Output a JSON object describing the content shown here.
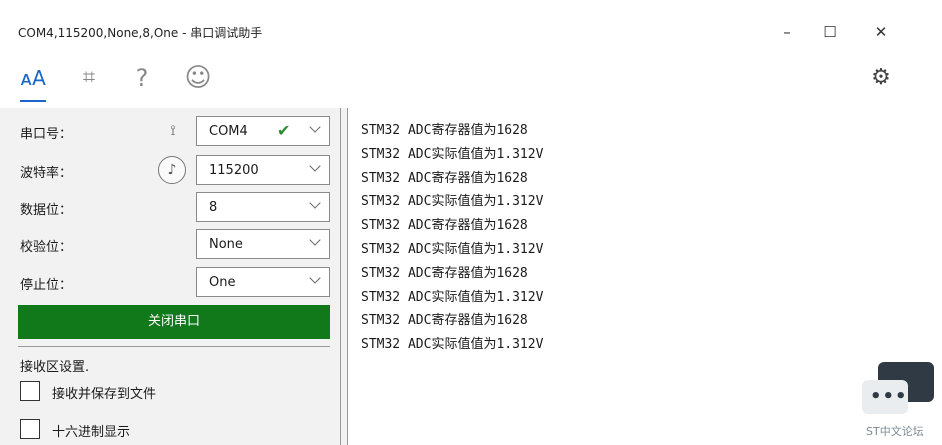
{
  "window": {
    "title": "COM4,115200,None,8,One - 串口调试助手",
    "min_glyph": "–",
    "max_glyph": "☐",
    "close_glyph": "✕"
  },
  "toolbar": {
    "items": [
      {
        "name": "font",
        "glyph": "ᴀA",
        "icon": "font-size-icon",
        "active": true
      },
      {
        "name": "crop",
        "glyph": "⌗",
        "icon": "crop-icon"
      },
      {
        "name": "help",
        "glyph": "?",
        "icon": "help-icon"
      },
      {
        "name": "smile",
        "glyph": "☺",
        "icon": "smiley-icon"
      },
      {
        "name": "settings",
        "glyph": "⚙",
        "icon": "gear-icon"
      }
    ],
    "accent": "#1a66c8"
  },
  "settings": {
    "port": {
      "label": "串口号：",
      "value": "COM4",
      "icon": "port-search-icon",
      "glyph": "⟟",
      "check": "✔"
    },
    "baud": {
      "label": "波特率：",
      "value": "115200",
      "icon": "dial-icon",
      "glyph": "♪"
    },
    "databits": {
      "label": "数据位：",
      "value": "8"
    },
    "parity": {
      "label": "校验位：",
      "value": "None"
    },
    "stopbits": {
      "label": "停止位：",
      "value": "One"
    },
    "toggle_button": "关闭串口",
    "toggle_color": "#11791a"
  },
  "receive": {
    "section_title": "接收区设置.",
    "save_to_file": "接收并保存到文件",
    "hex_display": "十六进制显示",
    "lines": [
      "STM32 ADC寄存器值为1628",
      "STM32 ADC实际值值为1.312V",
      "STM32 ADC寄存器值为1628",
      "STM32 ADC实际值值为1.312V",
      "STM32 ADC寄存器值为1628",
      "STM32 ADC实际值值为1.312V",
      "STM32 ADC寄存器值为1628",
      "STM32 ADC实际值值为1.312V",
      "STM32 ADC寄存器值为1628",
      "STM32 ADC实际值值为1.312V"
    ]
  },
  "watermark": {
    "label": "ST中文论坛",
    "dots": "•••"
  }
}
